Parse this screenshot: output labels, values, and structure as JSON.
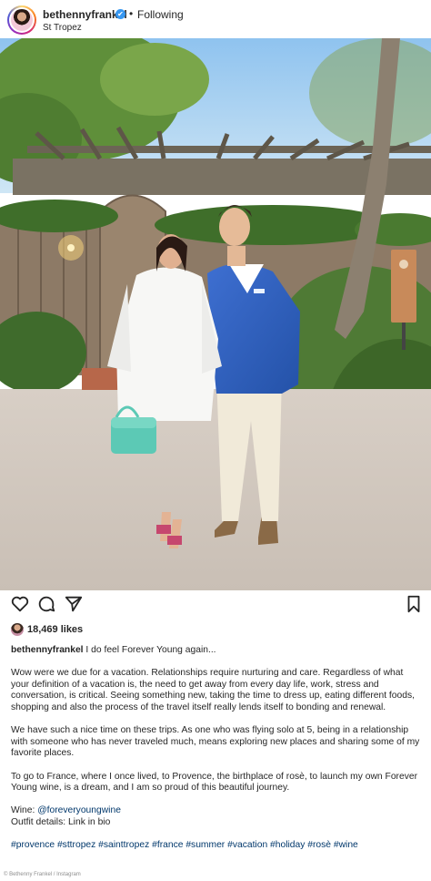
{
  "header": {
    "username": "bethennyfrankel",
    "verified_icon": "✔",
    "separator": "•",
    "follow_status": "Following",
    "location": "St Tropez"
  },
  "actions": {
    "icons": [
      "heart-icon",
      "comment-icon",
      "share-icon",
      "bookmark-icon"
    ]
  },
  "likes": {
    "count_text": "18,469 likes"
  },
  "caption": {
    "username": "bethennyfrankel",
    "headline": "I do feel Forever Young again...",
    "paragraph_1": "Wow were we due for a vacation. Relationships require nurturing and care. Regardless of what your definition of a vacation is, the need to get away from every day life, work, stress and conversation, is critical. Seeing something new, taking the time to dress up, eating different foods, shopping and also the process of the travel itself really lends itself to bonding and renewal.",
    "paragraph_2": "We have such a nice time on these trips. As one who was flying solo at 5, being in a relationship with someone who has never traveled much, means exploring new places and sharing some of my favorite places.",
    "paragraph_3": "To go to France, where I once lived, to Provence, the birthplace of rosè, to launch my own Forever Young wine, is a dream, and I am so proud of this beautiful journey.",
    "wine_label": "Wine: ",
    "wine_handle": "@foreveryoungwine",
    "outfit": "Outfit details: Link in bio",
    "hashtags": "#provence #sttropez #sainttropez #france #summer #vacation #holiday #rosè #wine"
  },
  "credit": "© Bethenny Frankel / Instagram"
}
